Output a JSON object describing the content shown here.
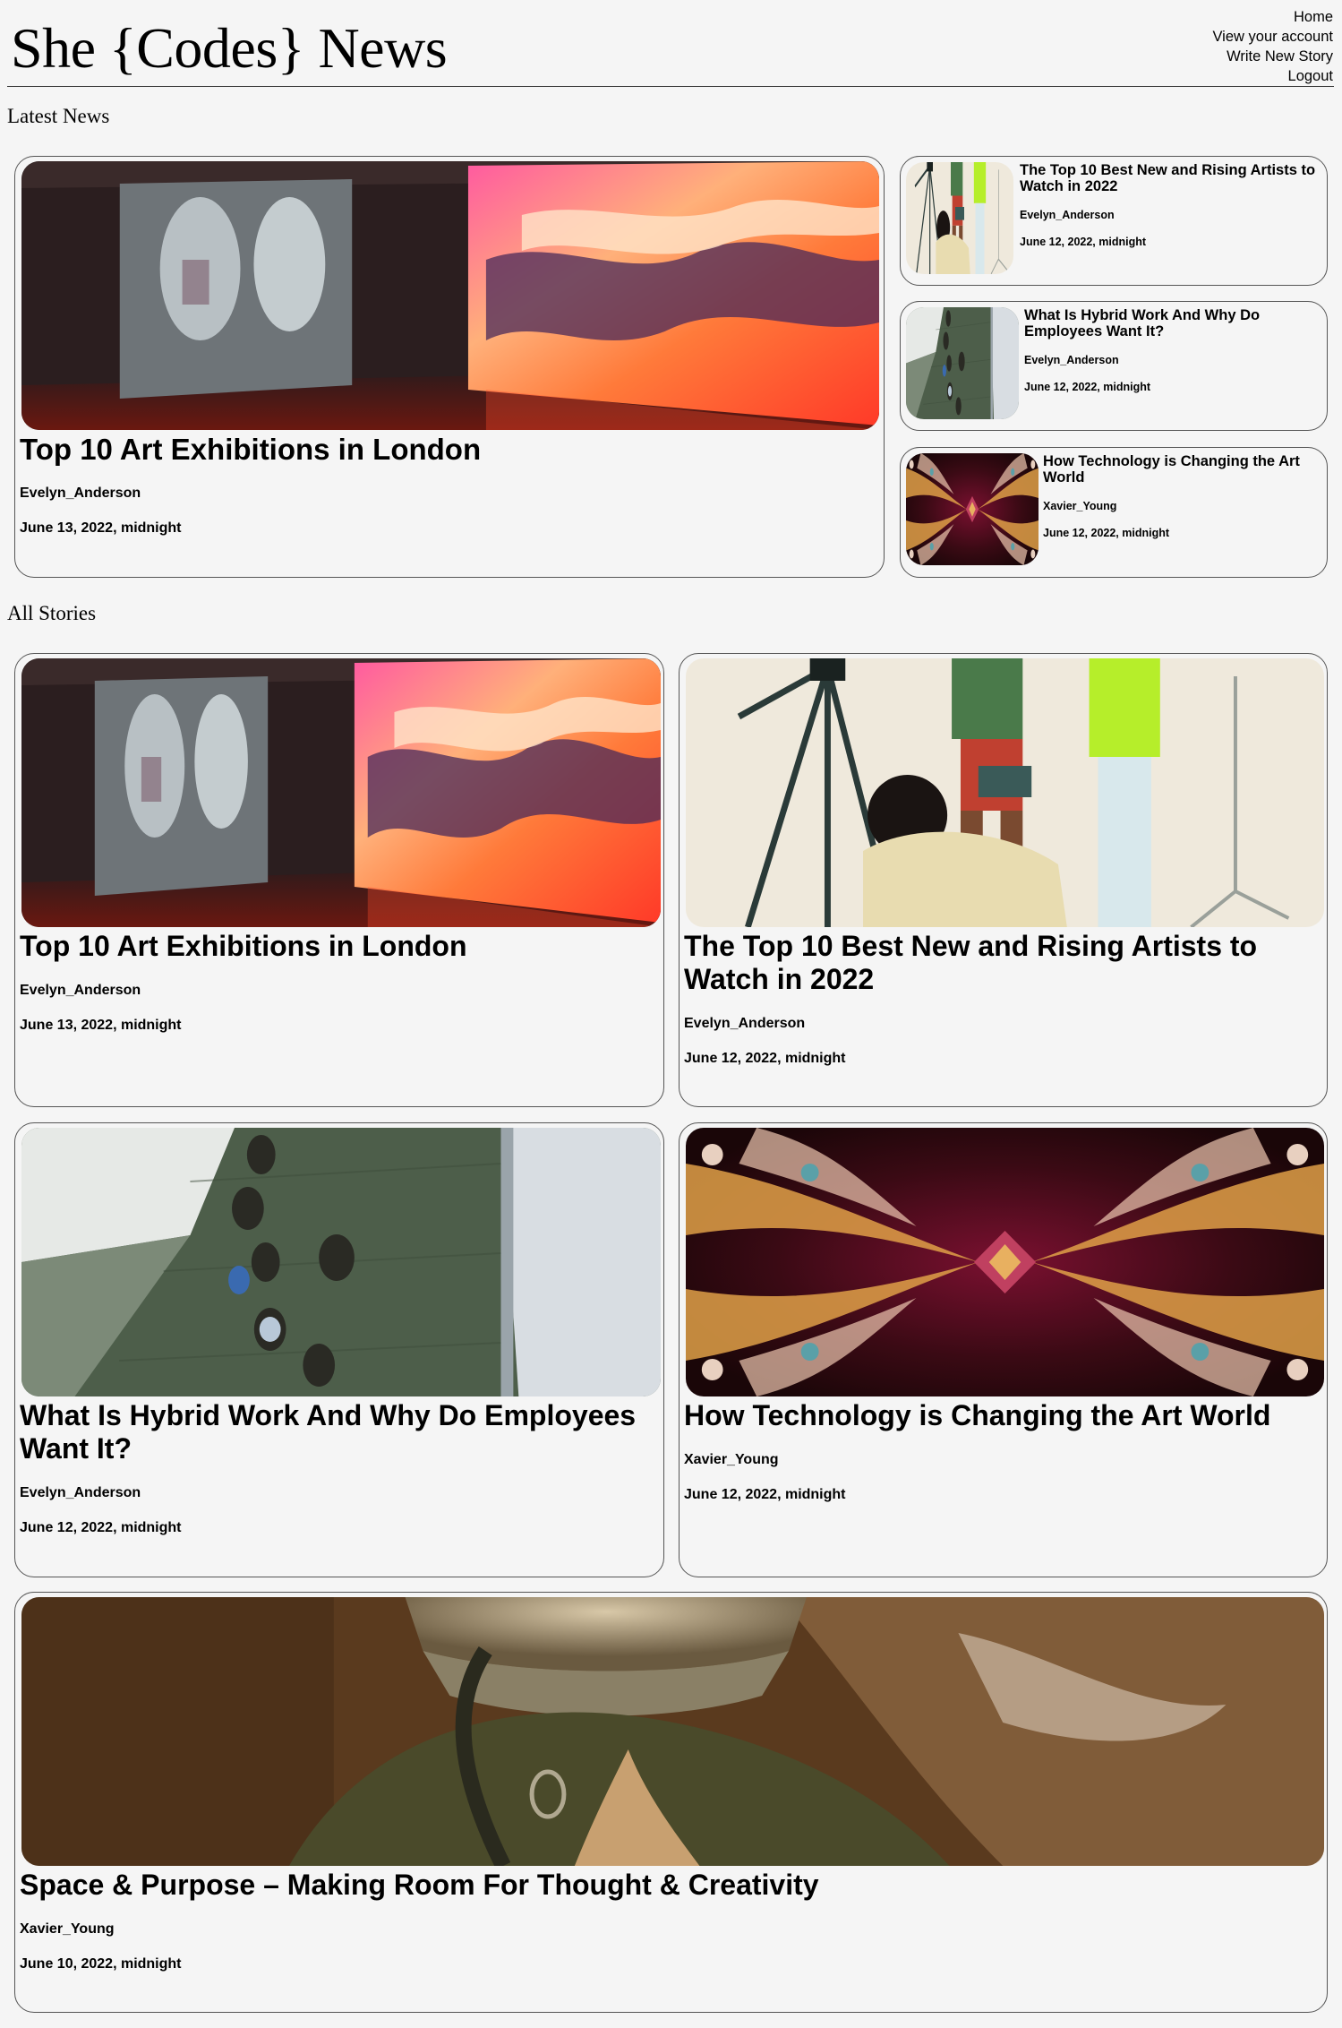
{
  "site": {
    "title": "She {Codes} News"
  },
  "nav": [
    "Home",
    "View your account",
    "Write New Story",
    "Logout"
  ],
  "latest": {
    "heading": "Latest News",
    "featured": {
      "title": "Top 10 Art Exhibitions in London",
      "author": "Evelyn_Anderson",
      "date": "June 13, 2022, midnight"
    },
    "side": [
      {
        "title": "The Top 10 Best New and Rising Artists to Watch in 2022",
        "author": "Evelyn_Anderson",
        "date": "June 12, 2022, midnight"
      },
      {
        "title": "What Is Hybrid Work And Why Do Employees Want It?",
        "author": "Evelyn_Anderson",
        "date": "June 12, 2022, midnight"
      },
      {
        "title": "How Technology is Changing the Art World",
        "author": "Xavier_Young",
        "date": "June 12, 2022, midnight"
      }
    ]
  },
  "all": {
    "heading": "All Stories",
    "stories": [
      {
        "title": "Top 10 Art Exhibitions in London",
        "author": "Evelyn_Anderson",
        "date": "June 13, 2022, midnight"
      },
      {
        "title": "The Top 10 Best New and Rising Artists to Watch in 2022",
        "author": "Evelyn_Anderson",
        "date": "June 12, 2022, midnight"
      },
      {
        "title": "What Is Hybrid Work And Why Do Employees Want It?",
        "author": "Evelyn_Anderson",
        "date": "June 12, 2022, midnight"
      },
      {
        "title": "How Technology is Changing the Art World",
        "author": "Xavier_Young",
        "date": "June 12, 2022, midnight"
      },
      {
        "title": "Space & Purpose – Making Room For Thought & Creativity",
        "author": "Xavier_Young",
        "date": "June 10, 2022, midnight"
      }
    ]
  }
}
